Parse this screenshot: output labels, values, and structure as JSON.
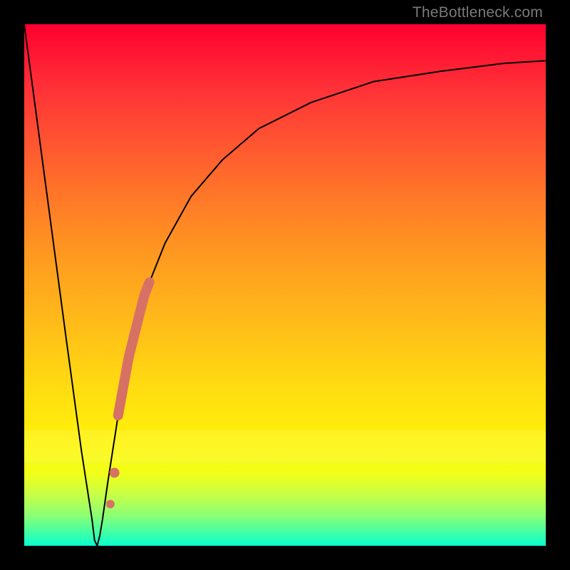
{
  "attribution": "TheBottleneck.com",
  "chart_data": {
    "type": "line",
    "title": "",
    "xlabel": "",
    "ylabel": "",
    "xlim": [
      0,
      100
    ],
    "ylim": [
      0,
      100
    ],
    "series": [
      {
        "name": "bottleneck-curve",
        "x": [
          0,
          4,
          8,
          11,
          13,
          13.5,
          14,
          14.5,
          15,
          16,
          18,
          20,
          23,
          27,
          32,
          38,
          45,
          55,
          67,
          80,
          92,
          100
        ],
        "y": [
          100,
          70,
          40,
          18,
          5,
          1,
          0,
          2,
          5,
          12,
          25,
          36,
          48,
          58,
          67,
          74,
          80,
          85,
          89,
          91,
          92.5,
          93
        ]
      }
    ],
    "highlighted_segment": {
      "name": "thick-marker-band",
      "x_start": 18,
      "x_end": 24,
      "y_start": 25,
      "y_end": 51
    },
    "marker_dots": [
      {
        "x": 17.3,
        "y": 14
      },
      {
        "x": 16.5,
        "y": 8
      }
    ],
    "gradient_meaning": "top-red-high-bottleneck-to-bottom-green-low-bottleneck"
  }
}
